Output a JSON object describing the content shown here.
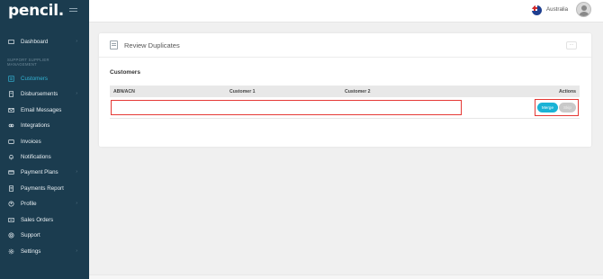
{
  "brand": {
    "logo_text": "pencil",
    "logo_dot": "."
  },
  "sidebar": {
    "section_label": "SUPPORT SUPPLIER MANAGEMENT",
    "items": [
      {
        "label": "Dashboard",
        "icon": "dashboard-icon",
        "chevron": "›"
      },
      {
        "label": "Customers",
        "icon": "customers-icon",
        "active": true
      },
      {
        "label": "Disbursements",
        "icon": "disbursements-icon",
        "chevron": "›"
      },
      {
        "label": "Email Messages",
        "icon": "email-icon"
      },
      {
        "label": "Integrations",
        "icon": "integrations-icon"
      },
      {
        "label": "Invoices",
        "icon": "invoices-icon"
      },
      {
        "label": "Notifications",
        "icon": "bell-icon"
      },
      {
        "label": "Payment Plans",
        "icon": "payment-plans-icon",
        "chevron": "›"
      },
      {
        "label": "Payments Report",
        "icon": "report-icon"
      },
      {
        "label": "Profile",
        "icon": "profile-icon",
        "chevron": "›"
      },
      {
        "label": "Sales Orders",
        "icon": "sales-orders-icon"
      },
      {
        "label": "Support",
        "icon": "support-icon"
      },
      {
        "label": "Settings",
        "icon": "gear-icon",
        "chevron": "›"
      }
    ]
  },
  "topbar": {
    "country": "Australia"
  },
  "card": {
    "title": "Review Duplicates",
    "menu_label": "···",
    "section_title": "Customers",
    "columns": [
      "ABN/ACN",
      "Customer 1",
      "Customer 2",
      "Actions"
    ],
    "row": {
      "merge_label": "Merge",
      "skip_label": "Skip"
    }
  },
  "colors": {
    "sidebar": "#1b3c4f",
    "accent": "#19b3d6",
    "highlight": "#e53935"
  }
}
